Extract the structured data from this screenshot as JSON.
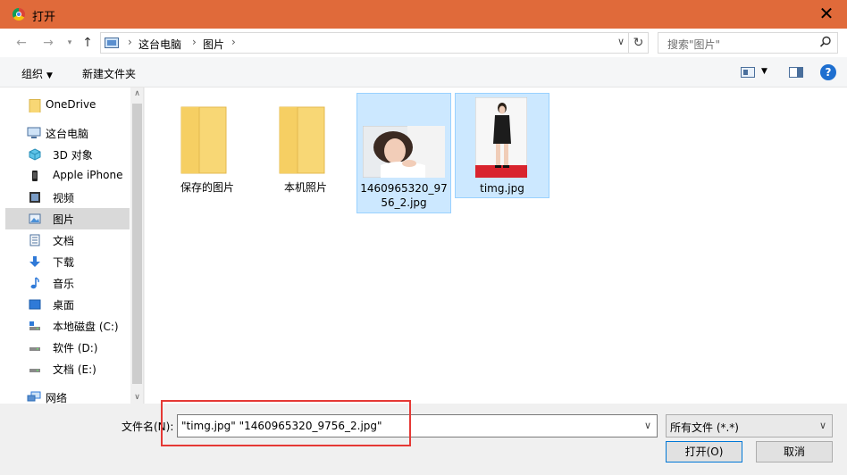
{
  "window": {
    "title": "打开"
  },
  "address": {
    "root": "这台电脑",
    "folder": "图片"
  },
  "search": {
    "placeholder": "搜索\"图片\""
  },
  "toolbar": {
    "organize": "组织",
    "new_folder": "新建文件夹"
  },
  "sidebar": {
    "items": [
      {
        "label": "OneDrive",
        "icon": "folder-icon"
      },
      {
        "label": "这台电脑",
        "icon": "computer-icon"
      },
      {
        "label": "3D 对象",
        "icon": "cube-icon"
      },
      {
        "label": "Apple iPhone",
        "icon": "phone-icon"
      },
      {
        "label": "视频",
        "icon": "video-icon"
      },
      {
        "label": "图片",
        "icon": "picture-icon",
        "selected": true
      },
      {
        "label": "文档",
        "icon": "document-icon"
      },
      {
        "label": "下载",
        "icon": "download-icon"
      },
      {
        "label": "音乐",
        "icon": "music-icon"
      },
      {
        "label": "桌面",
        "icon": "desktop-icon"
      },
      {
        "label": "本地磁盘 (C:)",
        "icon": "drive-icon"
      },
      {
        "label": "软件 (D:)",
        "icon": "drive-icon"
      },
      {
        "label": "文档 (E:)",
        "icon": "drive-icon"
      },
      {
        "label": "网络",
        "icon": "network-icon"
      }
    ]
  },
  "files": [
    {
      "name": "保存的图片",
      "type": "folder"
    },
    {
      "name": "本机照片",
      "type": "folder"
    },
    {
      "name": "1460965320_9756_2.jpg",
      "type": "image",
      "selected": true
    },
    {
      "name": "timg.jpg",
      "type": "image",
      "selected": true
    }
  ],
  "bottom": {
    "filename_label": "文件名(N):",
    "filename_value": "\"timg.jpg\" \"1460965320_9756_2.jpg\"",
    "filter_value": "所有文件 (*.*)",
    "open_button": "打开(O)",
    "cancel_button": "取消"
  },
  "colors": {
    "titlebar": "#e06a3a",
    "selection": "#cce8ff",
    "highlight_box": "#e53935",
    "folder": "#f8d775"
  }
}
